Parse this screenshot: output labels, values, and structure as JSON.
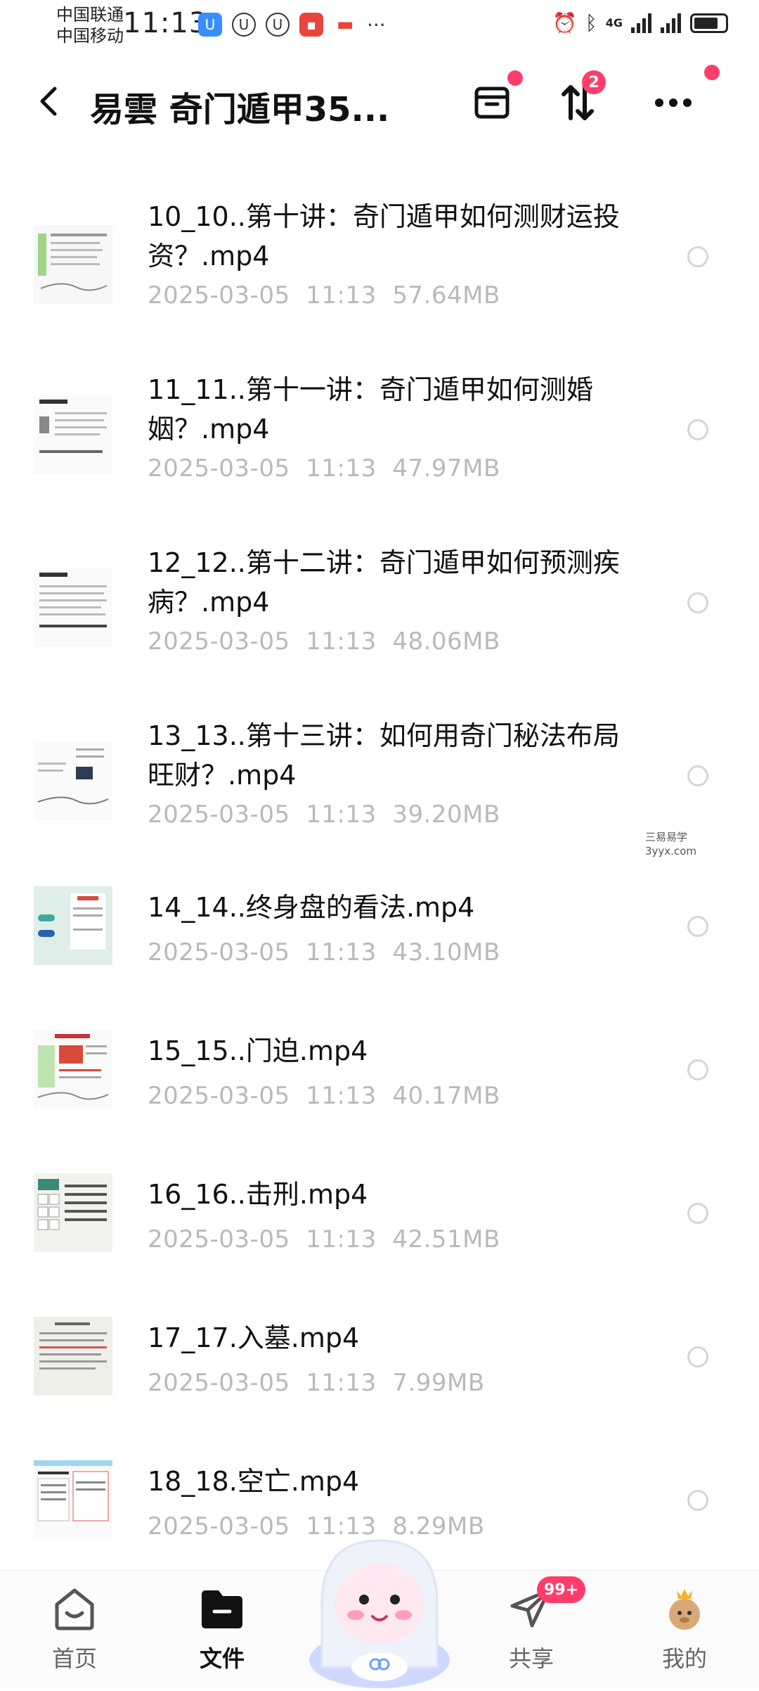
{
  "status_bar": {
    "carrier1": "中国联通",
    "carrier2": "中国移动",
    "time": "11:13",
    "network": "4G"
  },
  "header": {
    "back_icon": "chevron-left-icon",
    "title": "易雲 奇门遁甲35...",
    "sort_badge": "2"
  },
  "files": [
    {
      "name": "10_10..第十讲：奇门遁甲如何测财运投资？.mp4",
      "date": "2025-03-05",
      "time": "11:13",
      "size": "57.64MB"
    },
    {
      "name": "11_11..第十一讲：奇门遁甲如何测婚姻？.mp4",
      "date": "2025-03-05",
      "time": "11:13",
      "size": "47.97MB"
    },
    {
      "name": "12_12..第十二讲：奇门遁甲如何预测疾病？.mp4",
      "date": "2025-03-05",
      "time": "11:13",
      "size": "48.06MB"
    },
    {
      "name": "13_13..第十三讲：如何用奇门秘法布局旺财？.mp4",
      "date": "2025-03-05",
      "time": "11:13",
      "size": "39.20MB"
    },
    {
      "name": "14_14..终身盘的看法.mp4",
      "date": "2025-03-05",
      "time": "11:13",
      "size": "43.10MB"
    },
    {
      "name": "15_15..门迫.mp4",
      "date": "2025-03-05",
      "time": "11:13",
      "size": "40.17MB"
    },
    {
      "name": "16_16..击刑.mp4",
      "date": "2025-03-05",
      "time": "11:13",
      "size": "42.51MB"
    },
    {
      "name": "17_17.入墓.mp4",
      "date": "2025-03-05",
      "time": "11:13",
      "size": "7.99MB"
    },
    {
      "name": "18_18.空亡.mp4",
      "date": "2025-03-05",
      "time": "11:13",
      "size": "8.29MB"
    }
  ],
  "watermark": {
    "line1": "三易易学",
    "line2": "3yyx.com"
  },
  "bottom_nav": {
    "home": "首页",
    "files": "文件",
    "share": "共享",
    "share_badge": "99+",
    "mine": "我的"
  },
  "colors": {
    "accent": "#ff3d6b",
    "meta_text": "#b9b9b9"
  }
}
